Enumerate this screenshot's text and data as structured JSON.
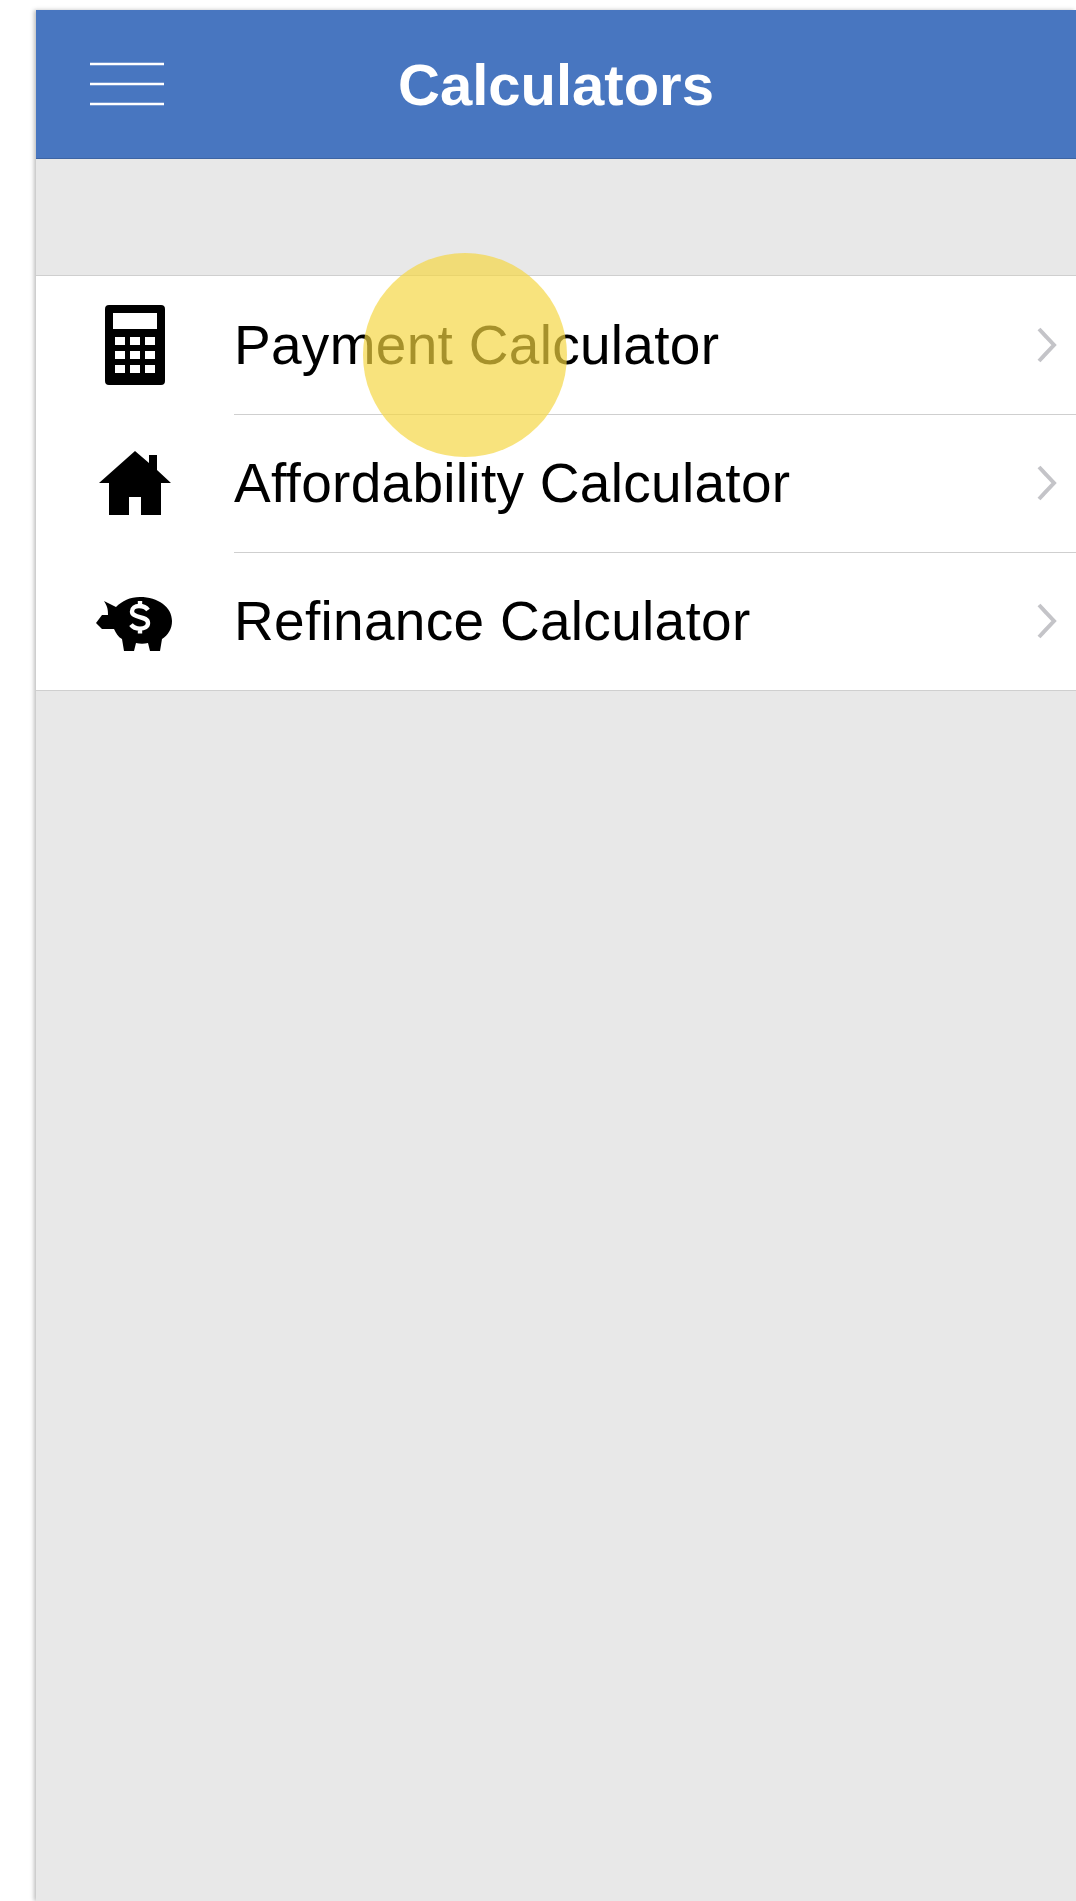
{
  "header": {
    "title": "Calculators"
  },
  "items": [
    {
      "label": "Payment Calculator",
      "kind": "calculator",
      "touched": true
    },
    {
      "label": "Affordability Calculator",
      "kind": "house",
      "touched": false
    },
    {
      "label": "Refinance Calculator",
      "kind": "piggy",
      "touched": false
    }
  ]
}
